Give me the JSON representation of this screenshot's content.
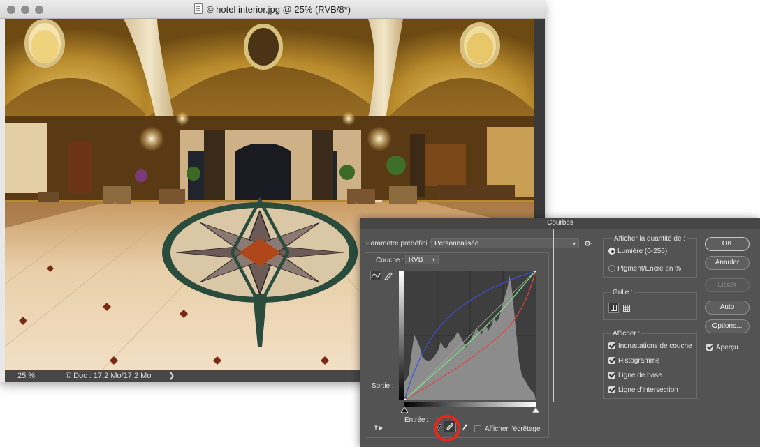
{
  "document": {
    "title": "© hotel interior.jpg @ 25% (RVB/8*)",
    "zoom": "25 %",
    "doc_info": "© Doc : 17,2 Mo/17,2 Mo",
    "info_arrow": "❯"
  },
  "curves": {
    "title": "Courbes",
    "preset_label": "Paramètre prédéfini :",
    "preset_value": "Personnalisée",
    "channel_label": "Couche :",
    "channel_value": "RVB",
    "output_label": "Sortie :",
    "input_label": "Entrée :",
    "show_clipping_label": "Afficher l'écrêtage",
    "show_clipping_checked": false,
    "show_amount": {
      "title": "Afficher la quantité de :",
      "options": [
        "Lumière (0-255)",
        "Pigment/Encre en %"
      ],
      "selected": 0
    },
    "grid": {
      "title": "Grille :"
    },
    "show": {
      "title": "Afficher :",
      "options": [
        {
          "label": "Incrustations de couche",
          "checked": true
        },
        {
          "label": "Histogramme",
          "checked": true
        },
        {
          "label": "Ligne de base",
          "checked": true
        },
        {
          "label": "Ligne d'intersection",
          "checked": true
        }
      ]
    },
    "buttons": {
      "ok": "OK",
      "cancel": "Annuler",
      "smooth": "Lisser",
      "auto": "Auto",
      "options": "Options..."
    },
    "preview": {
      "label": "Aperçu",
      "checked": true
    }
  },
  "colors": {
    "dialog_bg": "#535353",
    "red_curve": "#e0443b",
    "green_curve": "#7fe07f",
    "blue_curve": "#3f4fe0",
    "highlight": "#e8261a"
  }
}
